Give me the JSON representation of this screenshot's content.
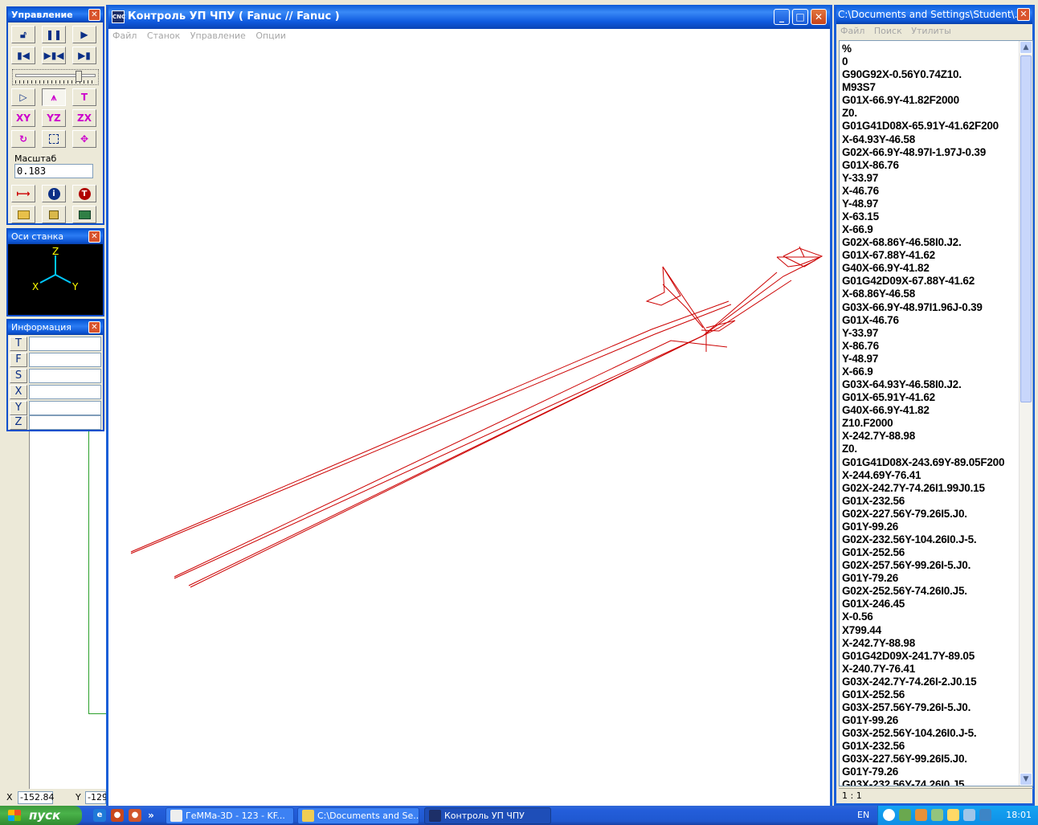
{
  "control_panel": {
    "title": "Управление",
    "scale_label": "Масштаб",
    "scale_value": "0.183",
    "view_buttons": [
      "XY",
      "YZ",
      "ZX"
    ]
  },
  "axes_panel": {
    "title": "Оси станка",
    "labels": {
      "x": "X",
      "y": "Y",
      "z": "Z"
    }
  },
  "info_panel": {
    "title": "Информация",
    "rows": [
      {
        "key": "T",
        "value": ""
      },
      {
        "key": "F",
        "value": ""
      },
      {
        "key": "S",
        "value": ""
      },
      {
        "key": "X",
        "value": ""
      },
      {
        "key": "Y",
        "value": ""
      },
      {
        "key": "Z",
        "value": ""
      }
    ]
  },
  "coords": {
    "x_label": "X",
    "x_value": "-152.84",
    "y_label": "Y",
    "y_value": "-129"
  },
  "main_window": {
    "icon_text": "CNC",
    "title": "Контроль УП ЧПУ ( Fanuc // Fanuc )",
    "menu": [
      "Файл",
      "Станок",
      "Управление",
      "Опции"
    ]
  },
  "code_window": {
    "title": "C:\\Documents and Settings\\Student\\...",
    "menu": [
      "Файл",
      "Поиск",
      "Утилиты"
    ],
    "status": "1 : 1",
    "lines": [
      "%",
      "0",
      "G90G92X-0.56Y0.74Z10.",
      "M93S7",
      "G01X-66.9Y-41.82F2000",
      "Z0.",
      "G01G41D08X-65.91Y-41.62F200",
      "X-64.93Y-46.58",
      "G02X-66.9Y-48.97I-1.97J-0.39",
      "G01X-86.76",
      "Y-33.97",
      "X-46.76",
      "Y-48.97",
      "X-63.15",
      "X-66.9",
      "G02X-68.86Y-46.58I0.J2.",
      "G01X-67.88Y-41.62",
      "G40X-66.9Y-41.82",
      "G01G42D09X-67.88Y-41.62",
      "X-68.86Y-46.58",
      "G03X-66.9Y-48.97I1.96J-0.39",
      "G01X-46.76",
      "Y-33.97",
      "X-86.76",
      "Y-48.97",
      "X-66.9",
      "G03X-64.93Y-46.58I0.J2.",
      "G01X-65.91Y-41.62",
      "G40X-66.9Y-41.82",
      "Z10.F2000",
      "X-242.7Y-88.98",
      "Z0.",
      "G01G41D08X-243.69Y-89.05F200",
      "X-244.69Y-76.41",
      "G02X-242.7Y-74.26I1.99J0.15",
      "G01X-232.56",
      "G02X-227.56Y-79.26I5.J0.",
      "G01Y-99.26",
      "G02X-232.56Y-104.26I0.J-5.",
      "G01X-252.56",
      "G02X-257.56Y-99.26I-5.J0.",
      "G01Y-79.26",
      "G02X-252.56Y-74.26I0.J5.",
      "G01X-246.45",
      "X-0.56",
      "X799.44",
      "X-242.7Y-88.98",
      "G01G42D09X-241.7Y-89.05",
      "X-240.7Y-76.41",
      "G03X-242.7Y-74.26I-2.J0.15",
      "G01X-252.56",
      "G03X-257.56Y-79.26I-5.J0.",
      "G01Y-99.26",
      "G03X-252.56Y-104.26I0.J-5.",
      "G01X-232.56",
      "G03X-227.56Y-99.26I5.J0.",
      "G01Y-79.26",
      "G03X-232.56Y-74.26I0.J5"
    ]
  },
  "taskbar": {
    "start_label": "пуск",
    "tasks": [
      "ГеММа-3D - 123 - KF...",
      "C:\\Documents and Se...",
      "Контроль УП ЧПУ"
    ],
    "language": "EN",
    "clock": "18:01"
  },
  "colors": {
    "toolpath": "#cc0000",
    "axis_lines": "#00c8ff",
    "axis_labels": "#ffff00",
    "titlebar": "#0a5bd8"
  }
}
